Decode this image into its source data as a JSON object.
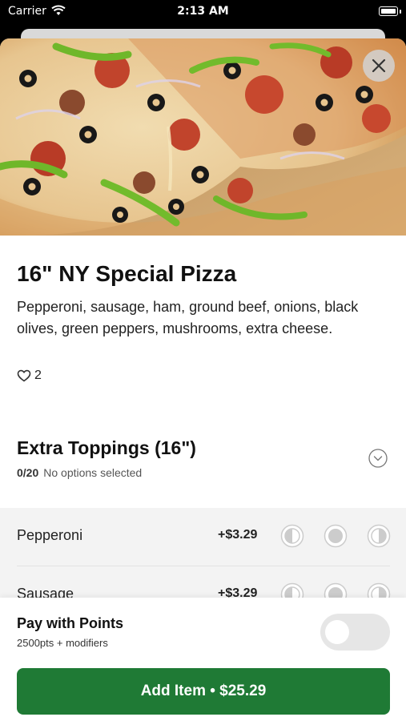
{
  "status_bar": {
    "carrier": "Carrier",
    "time": "2:13 AM"
  },
  "hero_image": {
    "subject": "pizza photo",
    "close_icon": "close-icon"
  },
  "item": {
    "title": "16\" NY Special Pizza",
    "description": "Pepperoni, sausage, ham, ground beef, onions, black olives, green peppers, mushrooms, extra cheese.",
    "likes": "2",
    "like_icon": "heart-icon"
  },
  "toppings": {
    "title": "Extra Toppings (16\")",
    "count": "0/20",
    "status": "No options selected",
    "chevron_icon": "chevron-down-icon",
    "options": [
      {
        "name": "Pepperoni",
        "price": "+$3.29"
      },
      {
        "name": "Sausage",
        "price": "+$3.29"
      }
    ],
    "placement_icons": [
      "left-half-icon",
      "whole-icon",
      "right-half-icon"
    ]
  },
  "footer": {
    "points_label": "Pay with Points",
    "points_sub": "2500pts + modifiers",
    "toggle_on": false,
    "add_button": "Add Item • $25.29"
  },
  "colors": {
    "accent_green": "#1f7a35",
    "options_bg": "#f3f3f3"
  }
}
